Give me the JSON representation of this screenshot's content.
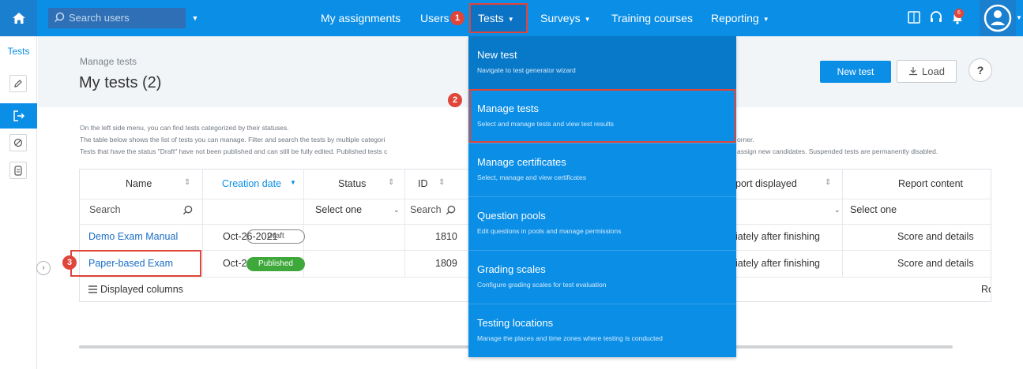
{
  "nav": {
    "search_placeholder": "Search users",
    "my_assignments": "My assignments",
    "users": "Users",
    "tests": "Tests",
    "surveys": "Surveys",
    "training_courses": "Training courses",
    "reporting": "Reporting",
    "notification_count": "6"
  },
  "steps": [
    "1",
    "2",
    "3"
  ],
  "sidebar": {
    "title": "Tests"
  },
  "header": {
    "breadcrumb": "Manage tests",
    "title": "My tests (2)",
    "new_test": "New test",
    "load": "Load",
    "help": "?"
  },
  "description": [
    "On the left side menu, you can find tests categorized by their statuses.",
    "The table below shows the list of tests you can manage. Filter and search the tests by multiple categori",
    "Tests that have the status \"Draft\" have not been published and can still be fully edited. Published tests c"
  ],
  "description_right": [
    "orner.",
    "assign new candidates. Suspended tests are permanently disabled."
  ],
  "table": {
    "columns": [
      "Name",
      "Creation date",
      "Status",
      "ID",
      "port displayed",
      "Report content"
    ],
    "filters": {
      "name_placeholder": "Search",
      "status": "Select one",
      "id_placeholder": "Search",
      "report_content": "Select one"
    },
    "rows": [
      {
        "name": "Demo Exam Manual",
        "date": "Oct-26-2021",
        "status": "Draft",
        "id": "1810",
        "report": "iately after finishing",
        "content": "Score and details"
      },
      {
        "name": "Paper-based Exam",
        "date": "Oct-26-2021",
        "status": "Published",
        "id": "1809",
        "report": "iately after finishing",
        "content": "Score and details"
      }
    ],
    "displayed_columns": "Displayed columns",
    "footer_right": "Ro"
  },
  "menu": [
    {
      "title": "New test",
      "subtitle": "Navigate to test generator wizard"
    },
    {
      "title": "Manage tests",
      "subtitle": "Select and manage tests and view test results"
    },
    {
      "title": "Manage certificates",
      "subtitle": "Select, manage and view certificates"
    },
    {
      "title": "Question pools",
      "subtitle": "Edit questions in pools and manage permissions"
    },
    {
      "title": "Grading scales",
      "subtitle": "Configure grading scales for test evaluation"
    },
    {
      "title": "Testing locations",
      "subtitle": "Manage the places and time zones where testing is conducted"
    }
  ],
  "colors": {
    "primary": "#0a8ee6",
    "highlight": "#e0453a",
    "published": "#3fa83b"
  }
}
